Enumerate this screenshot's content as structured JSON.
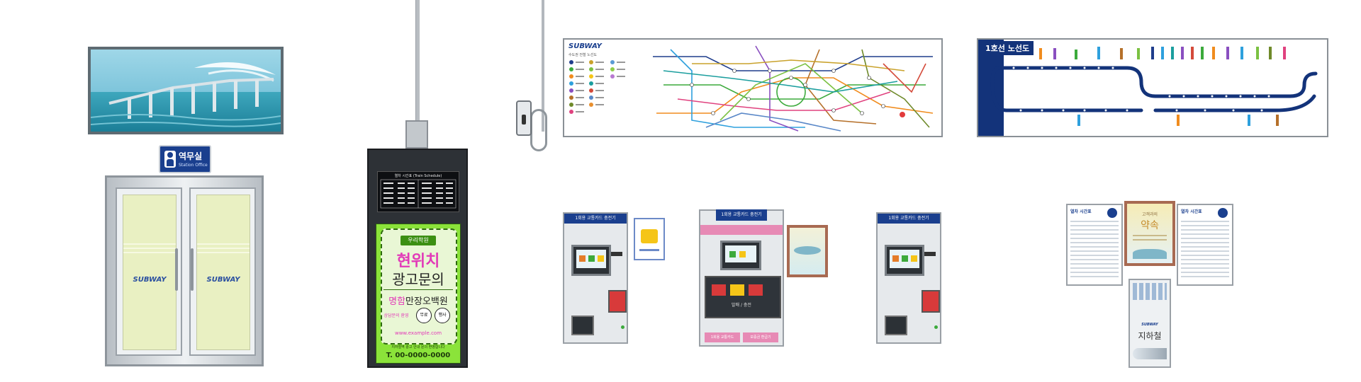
{
  "sprites": {
    "station_office": {
      "sign_text": "역무실",
      "sign_subtext": "Station Office",
      "door_brand": "SUBWAY"
    },
    "ad_board": {
      "schedule_title": "열차 시간표 (Train Schedule)",
      "badge": "우리학원",
      "headline_line1": "현위치",
      "headline_line2": "광고문의",
      "tagline_pink": "명함",
      "tagline_rest": "만장오백원",
      "circle1": "무료",
      "circle2": "행사",
      "note": "상담문의 환영",
      "website": "www.example.com",
      "small_print": "지하철역 광고 안내 문의 환영합니다",
      "phone": "T. 00-0000-0000"
    },
    "subway_map": {
      "brand": "SUBWAY",
      "legend_title": "수도권 전철 노선도"
    },
    "line1_map": {
      "title": "1호선 노선도"
    },
    "kiosks": {
      "header_left": "1회용 교통카드 충전기",
      "header_center": "1회용 교통카드 충전기",
      "buttons_label": "발매 / 충전",
      "center_caption_left": "1회용 교통카드",
      "center_caption_right": "보증금 환급기"
    },
    "posters": {
      "left_title": "열차 시간표",
      "center_title": "약속",
      "center_subtitle": "고객과의",
      "right_title": "열차 시간표",
      "stand_brand": "SUBWAY",
      "stand_title": "지하철"
    }
  },
  "colors": {
    "brand_blue": "#1a3f8e",
    "metro_blue": "#13337a",
    "ad_green": "#8be33a",
    "ad_pink": "#e23ab8",
    "kiosk_pink": "#e78ab5"
  }
}
